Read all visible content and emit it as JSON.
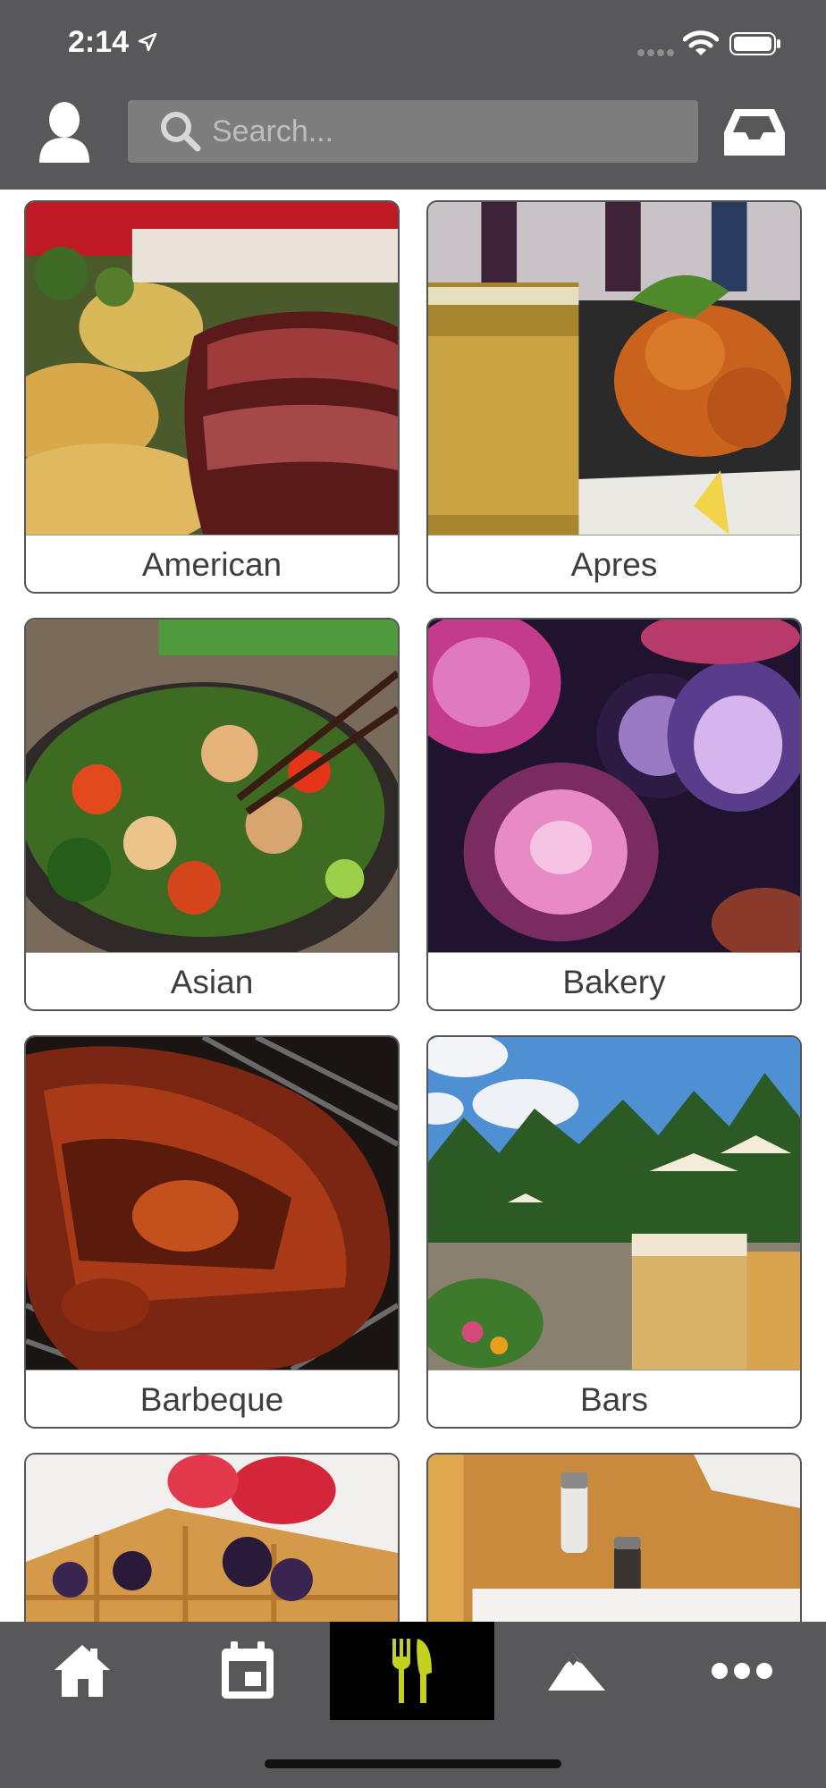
{
  "status_bar": {
    "time": "2:14"
  },
  "header": {
    "search": {
      "placeholder": "Search..."
    }
  },
  "categories": [
    {
      "label": "American",
      "image": "steak-potatoes-photo"
    },
    {
      "label": "Apres",
      "image": "beer-fried-shrimp-photo"
    },
    {
      "label": "Asian",
      "image": "stir-fry-photo"
    },
    {
      "label": "Bakery",
      "image": "pink-glass-bowls-photo"
    },
    {
      "label": "Barbeque",
      "image": "grilled-ribs-photo"
    },
    {
      "label": "Bars",
      "image": "patio-beer-photo"
    },
    {
      "label": "",
      "image": "waffles-berries-photo"
    },
    {
      "label": "",
      "image": "wood-table-shakers-photo"
    }
  ],
  "tabbar": {
    "tabs": [
      {
        "icon": "home-icon"
      },
      {
        "icon": "calendar-icon"
      },
      {
        "icon": "fork-knife-icon",
        "active": true
      },
      {
        "icon": "mountain-icon"
      },
      {
        "icon": "more-icon"
      }
    ],
    "active_color": "#c3d21f"
  }
}
